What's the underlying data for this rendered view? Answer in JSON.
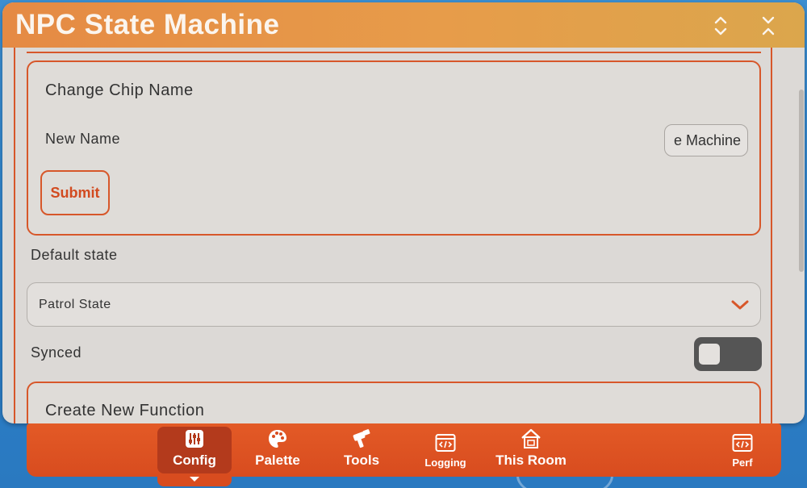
{
  "window": {
    "title": "NPC State Machine",
    "collapse_icon": "chevron-up-down-icon",
    "close_icon": "collapse-arrows-icon"
  },
  "change_chip_name": {
    "title": "Change Chip Name",
    "new_name_label": "New Name",
    "new_name_value": "e Machine",
    "submit_label": "Submit"
  },
  "default_state": {
    "label": "Default state",
    "selected": "Patrol State"
  },
  "synced": {
    "label": "Synced",
    "on": false
  },
  "create_function": {
    "title": "Create New Function"
  },
  "dock": {
    "tabs": [
      {
        "label": "Config",
        "icon": "sliders-icon",
        "active": true
      },
      {
        "label": "Palette",
        "icon": "palette-icon",
        "active": false
      },
      {
        "label": "Tools",
        "icon": "tools-icon",
        "active": false
      },
      {
        "label": "Logging",
        "icon": "code-window-icon",
        "active": false
      },
      {
        "label": "This Room",
        "icon": "house-icon",
        "active": false
      },
      {
        "label": "Perf",
        "icon": "code-window-icon",
        "active": false
      }
    ]
  },
  "colors": {
    "accent": "#d7572a",
    "title_bar": "#e79c4a",
    "panel_bg": "#dcd9d6",
    "dock_bg": "#d84c1f",
    "toggle_off": "#555555"
  }
}
